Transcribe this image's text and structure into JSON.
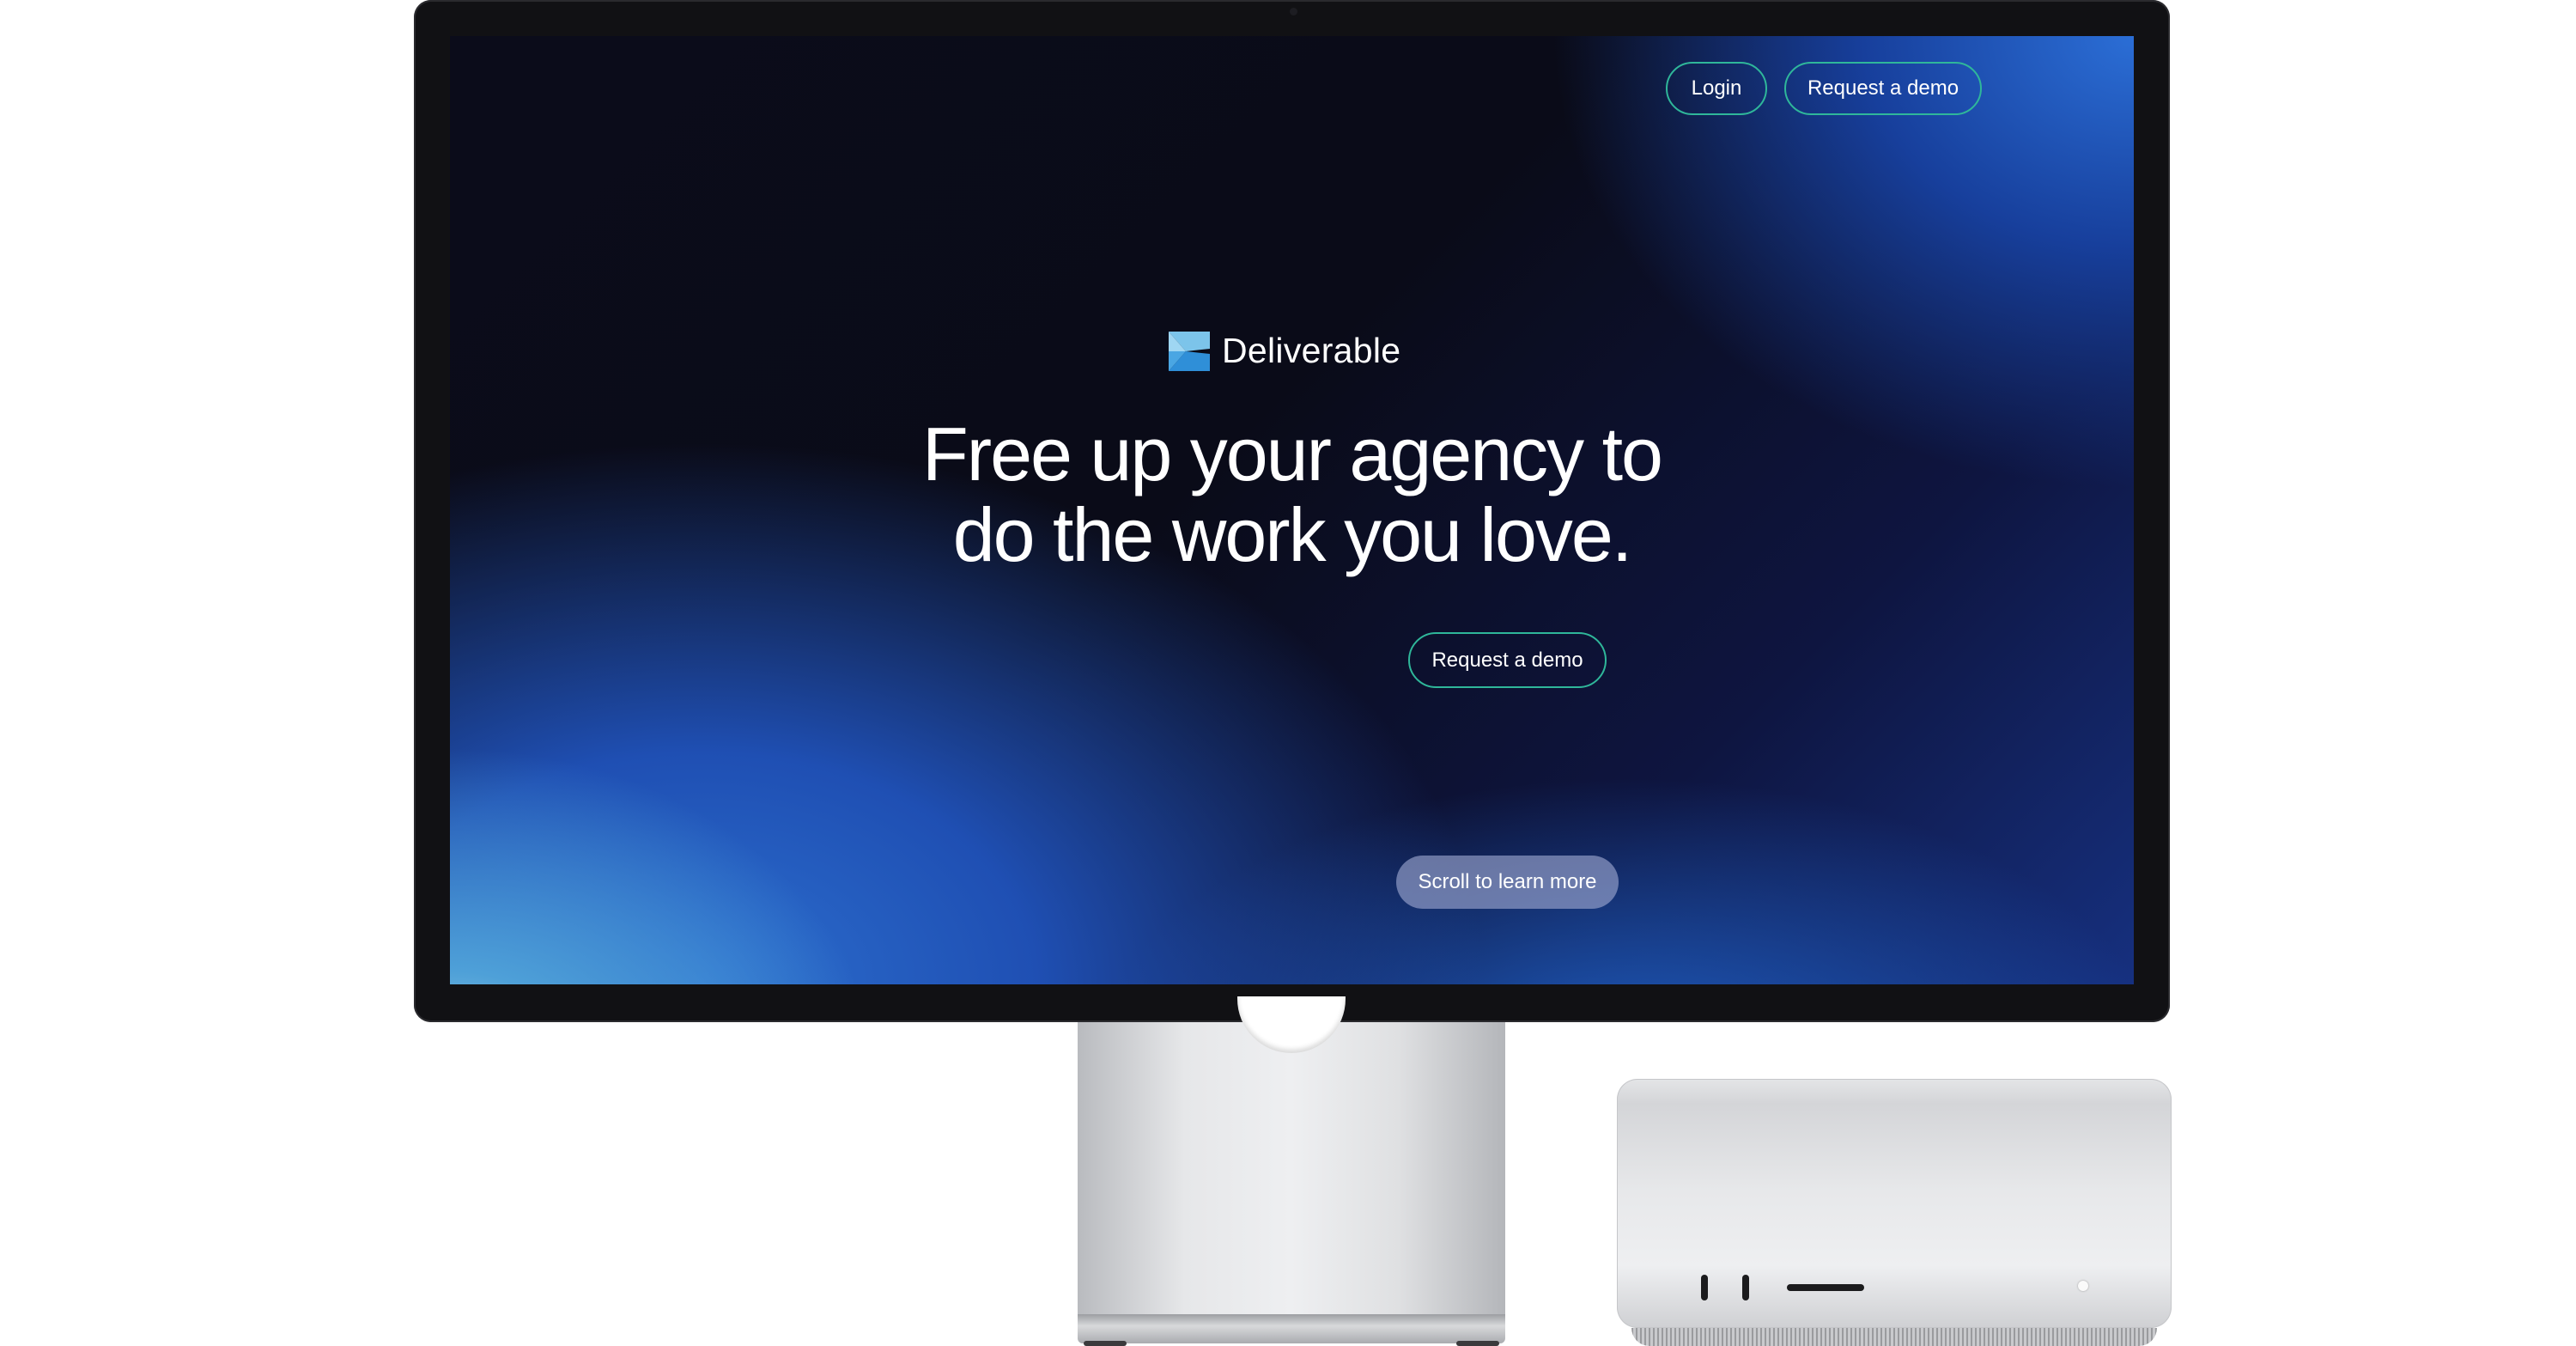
{
  "nav": {
    "login_label": "Login",
    "request_demo_label": "Request a demo"
  },
  "brand": {
    "logo_icon": "deliverable-logo-icon",
    "name": "Deliverable",
    "accent_color": "#2fb79a"
  },
  "hero": {
    "headline_line1": "Free up your agency to",
    "headline_line2": "do the work you love.",
    "cta_label": "Request a demo"
  },
  "scroll_hint": {
    "label": "Scroll to learn more"
  }
}
